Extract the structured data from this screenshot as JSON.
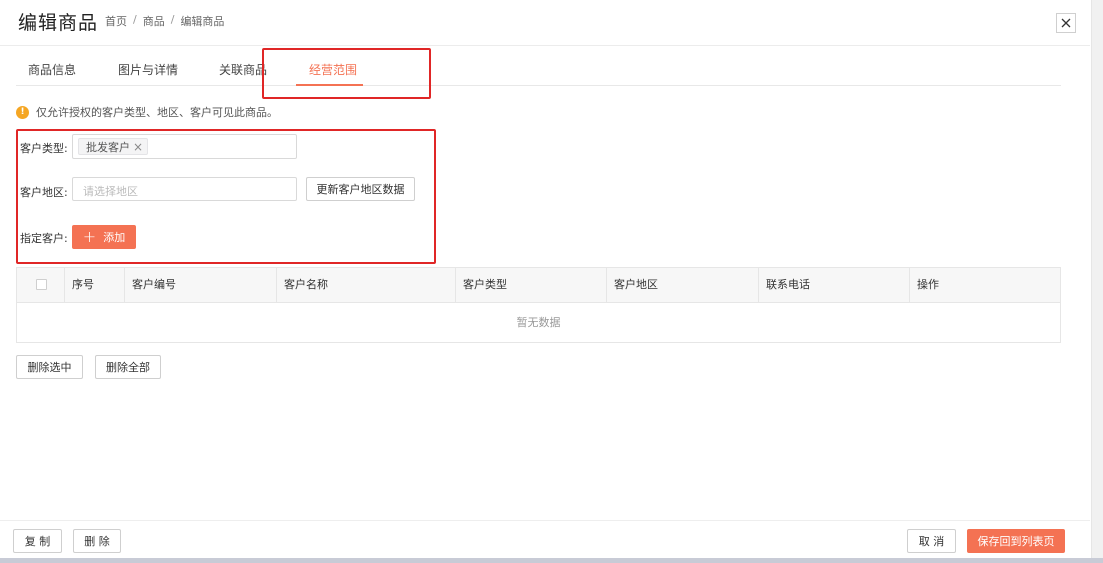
{
  "header": {
    "title": "编辑商品",
    "breadcrumb": [
      "首页",
      "商品",
      "编辑商品"
    ],
    "breadcrumb_separator": "/",
    "close_icon": "close-icon"
  },
  "tabs": [
    {
      "label": "商品信息",
      "active": false
    },
    {
      "label": "图片与详情",
      "active": false
    },
    {
      "label": "关联商品",
      "active": false
    },
    {
      "label": "经营范围",
      "active": true
    }
  ],
  "notice": {
    "icon": "info-icon",
    "text": "仅允许授权的客户类型、地区、客户可见此商品。"
  },
  "form": {
    "customer_type_label": "客户类型:",
    "customer_type_tag": "批发客户",
    "tag_close": "×",
    "region_label": "客户地区:",
    "region_placeholder": "请选择地区",
    "update_region_button": "更新客户地区数据",
    "assign_label": "指定客户:",
    "add_button": "添加",
    "add_icon": "+"
  },
  "table": {
    "columns": [
      "序号",
      "客户编号",
      "客户名称",
      "客户类型",
      "客户地区",
      "联系电话",
      "操作"
    ],
    "rows": [],
    "empty_text": "暂无数据"
  },
  "table_actions": {
    "delete_selected": "删除选中",
    "delete_all": "删除全部"
  },
  "footer": {
    "copy_button": "复 制",
    "delete_button": "删 除",
    "cancel_button": "取 消",
    "save_button": "保存回到列表页"
  },
  "colors": {
    "accent": "#f47253",
    "annotation_box": "#e02626",
    "warning": "#f5a623"
  }
}
